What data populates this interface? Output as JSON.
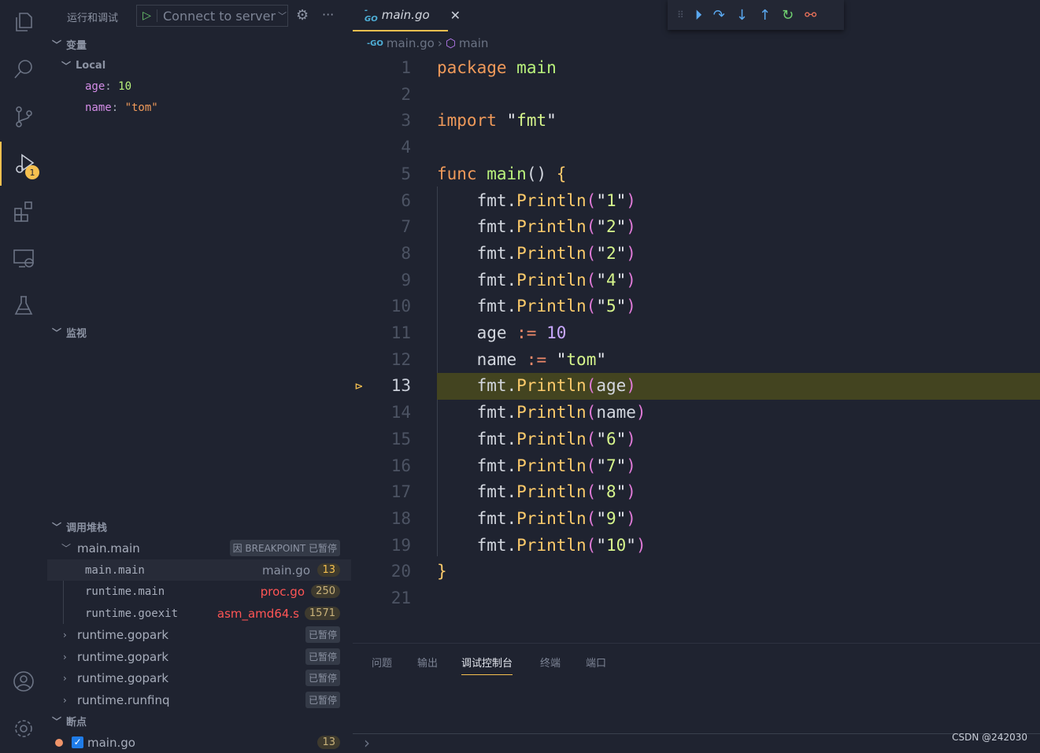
{
  "activity": [
    {
      "icon": "files-icon"
    },
    {
      "icon": "search-icon"
    },
    {
      "icon": "source-control-icon"
    },
    {
      "icon": "run-debug-icon",
      "badge": "1"
    },
    {
      "icon": "extensions-icon"
    },
    {
      "icon": "remote-explorer-icon"
    },
    {
      "icon": "testing-icon"
    },
    {
      "icon": "account-icon"
    },
    {
      "icon": "settings-gear-icon"
    }
  ],
  "sidebar": {
    "title": "运行和调试",
    "config": "Connect to server",
    "variables": {
      "title": "变量",
      "scope": "Local",
      "items": [
        {
          "name": "age",
          "value": "10"
        },
        {
          "name": "name",
          "value": "\"tom\""
        }
      ]
    },
    "watch": {
      "title": "监视"
    },
    "callstack": {
      "title": "调用堆栈",
      "thread": "main.main",
      "thread_status": "因 BREAKPOINT 已暂停",
      "frames": [
        {
          "name": "main.main",
          "file": "main.go",
          "line": "13"
        },
        {
          "name": "runtime.main",
          "file": "proc.go",
          "line": "250"
        },
        {
          "name": "runtime.goexit",
          "file": "asm_amd64.s",
          "line": "1571"
        }
      ],
      "others": [
        {
          "name": "runtime.gopark",
          "status": "已暂停"
        },
        {
          "name": "runtime.gopark",
          "status": "已暂停"
        },
        {
          "name": "runtime.gopark",
          "status": "已暂停"
        },
        {
          "name": "runtime.runfinq",
          "status": "已暂停"
        }
      ]
    },
    "breakpoints": {
      "title": "断点",
      "items": [
        {
          "file": "main.go",
          "line": "13",
          "checked": true
        }
      ]
    }
  },
  "editor": {
    "tab": "main.go",
    "breadcrumb": [
      "main.go",
      "main"
    ],
    "current_line": 13,
    "lines": [
      [
        [
          "kw",
          "package"
        ],
        [
          "id",
          " "
        ],
        [
          "fn",
          "main"
        ]
      ],
      [],
      [
        [
          "kw",
          "import"
        ],
        [
          "id",
          " "
        ],
        [
          "q",
          "\""
        ],
        [
          "st",
          "fmt"
        ],
        [
          "q",
          "\""
        ]
      ],
      [],
      [
        [
          "kw",
          "func"
        ],
        [
          "id",
          " "
        ],
        [
          "fn",
          "main"
        ],
        [
          "id",
          "() "
        ],
        [
          "br",
          "{"
        ]
      ],
      [
        [
          "id",
          "    fmt."
        ],
        [
          "me",
          "Println"
        ],
        [
          "pa",
          "("
        ],
        [
          "q",
          "\""
        ],
        [
          "st",
          "1"
        ],
        [
          "q",
          "\""
        ],
        [
          "pa",
          ")"
        ]
      ],
      [
        [
          "id",
          "    fmt."
        ],
        [
          "me",
          "Println"
        ],
        [
          "pa",
          "("
        ],
        [
          "q",
          "\""
        ],
        [
          "st",
          "2"
        ],
        [
          "q",
          "\""
        ],
        [
          "pa",
          ")"
        ]
      ],
      [
        [
          "id",
          "    fmt."
        ],
        [
          "me",
          "Println"
        ],
        [
          "pa",
          "("
        ],
        [
          "q",
          "\""
        ],
        [
          "st",
          "2"
        ],
        [
          "q",
          "\""
        ],
        [
          "pa",
          ")"
        ]
      ],
      [
        [
          "id",
          "    fmt."
        ],
        [
          "me",
          "Println"
        ],
        [
          "pa",
          "("
        ],
        [
          "q",
          "\""
        ],
        [
          "st",
          "4"
        ],
        [
          "q",
          "\""
        ],
        [
          "pa",
          ")"
        ]
      ],
      [
        [
          "id",
          "    fmt."
        ],
        [
          "me",
          "Println"
        ],
        [
          "pa",
          "("
        ],
        [
          "q",
          "\""
        ],
        [
          "st",
          "5"
        ],
        [
          "q",
          "\""
        ],
        [
          "pa",
          ")"
        ]
      ],
      [
        [
          "id",
          "    age "
        ],
        [
          "op",
          ":="
        ],
        [
          "id",
          " "
        ],
        [
          "nu",
          "10"
        ]
      ],
      [
        [
          "id",
          "    name "
        ],
        [
          "op",
          ":="
        ],
        [
          "id",
          " "
        ],
        [
          "q",
          "\""
        ],
        [
          "st",
          "tom"
        ],
        [
          "q",
          "\""
        ]
      ],
      [
        [
          "id",
          "    fmt."
        ],
        [
          "me",
          "Println"
        ],
        [
          "pa",
          "("
        ],
        [
          "id",
          "age"
        ],
        [
          "pa",
          ")"
        ]
      ],
      [
        [
          "id",
          "    fmt."
        ],
        [
          "me",
          "Println"
        ],
        [
          "pa",
          "("
        ],
        [
          "id",
          "name"
        ],
        [
          "pa",
          ")"
        ]
      ],
      [
        [
          "id",
          "    fmt."
        ],
        [
          "me",
          "Println"
        ],
        [
          "pa",
          "("
        ],
        [
          "q",
          "\""
        ],
        [
          "st",
          "6"
        ],
        [
          "q",
          "\""
        ],
        [
          "pa",
          ")"
        ]
      ],
      [
        [
          "id",
          "    fmt."
        ],
        [
          "me",
          "Println"
        ],
        [
          "pa",
          "("
        ],
        [
          "q",
          "\""
        ],
        [
          "st",
          "7"
        ],
        [
          "q",
          "\""
        ],
        [
          "pa",
          ")"
        ]
      ],
      [
        [
          "id",
          "    fmt."
        ],
        [
          "me",
          "Println"
        ],
        [
          "pa",
          "("
        ],
        [
          "q",
          "\""
        ],
        [
          "st",
          "8"
        ],
        [
          "q",
          "\""
        ],
        [
          "pa",
          ")"
        ]
      ],
      [
        [
          "id",
          "    fmt."
        ],
        [
          "me",
          "Println"
        ],
        [
          "pa",
          "("
        ],
        [
          "q",
          "\""
        ],
        [
          "st",
          "9"
        ],
        [
          "q",
          "\""
        ],
        [
          "pa",
          ")"
        ]
      ],
      [
        [
          "id",
          "    fmt."
        ],
        [
          "me",
          "Println"
        ],
        [
          "pa",
          "("
        ],
        [
          "q",
          "\""
        ],
        [
          "st",
          "10"
        ],
        [
          "q",
          "\""
        ],
        [
          "pa",
          ")"
        ]
      ],
      [
        [
          "br",
          "}"
        ]
      ],
      []
    ]
  },
  "debug_toolbar": [
    "drag-handle-icon",
    "continue-icon",
    "step-over-icon",
    "step-into-icon",
    "step-out-icon",
    "restart-icon",
    "disconnect-icon"
  ],
  "panel": {
    "tabs": [
      "问题",
      "输出",
      "调试控制台",
      "终端",
      "端口"
    ],
    "active": "调试控制台",
    "prompt": "›"
  },
  "watermark": "CSDN @242030"
}
